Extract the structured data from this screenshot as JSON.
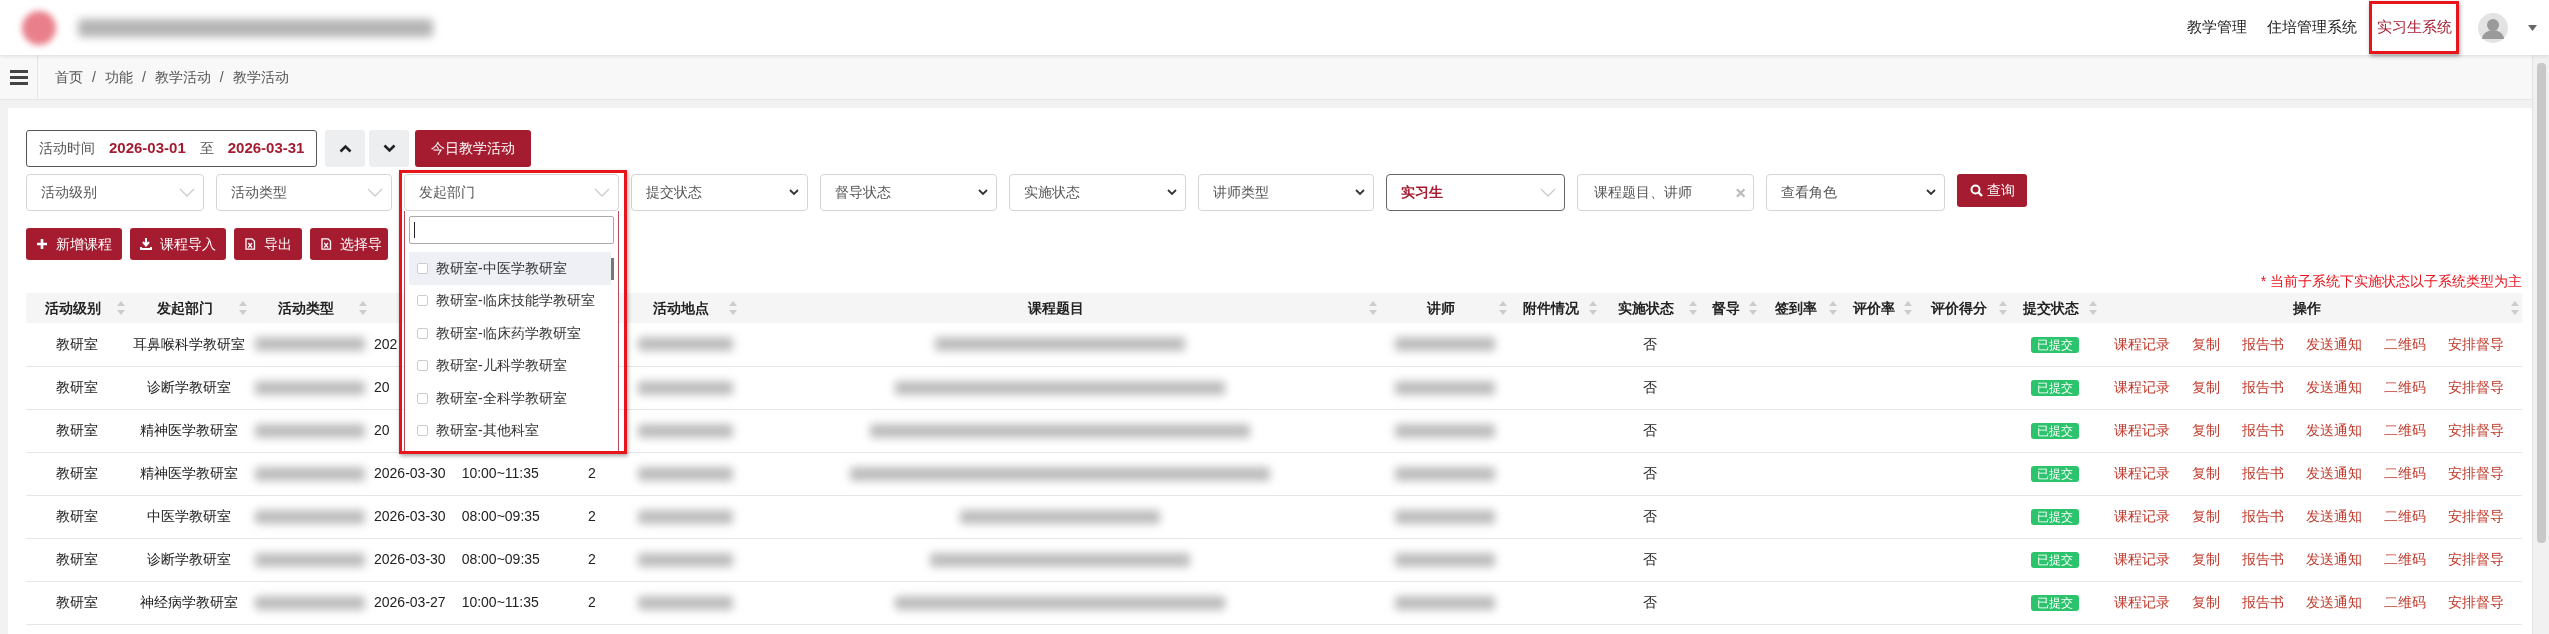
{
  "top_nav": [
    {
      "label": "教学管理",
      "selected": false,
      "highlighted": false
    },
    {
      "label": "住培管理系统",
      "selected": false,
      "highlighted": false
    },
    {
      "label": "实习生系统",
      "selected": true,
      "highlighted": true
    }
  ],
  "breadcrumb": {
    "separator": "/",
    "items": [
      "首页",
      "功能",
      "教学活动",
      "教学活动"
    ]
  },
  "date_range": {
    "label": "活动时间",
    "start": "2026-03-01",
    "separator": "至",
    "end": "2026-03-31"
  },
  "today_button": "今日教学活动",
  "filters": [
    {
      "kind": "select2",
      "placeholder": "活动级别"
    },
    {
      "kind": "select2",
      "placeholder": "活动类型"
    },
    {
      "kind": "select2",
      "placeholder": "发起部门",
      "open": true,
      "highlighted": true,
      "options": [
        {
          "label": "教研室-中医学教研室",
          "checked": false,
          "highlighted": true
        },
        {
          "label": "教研室-临床技能学教研室",
          "checked": false,
          "highlighted": false
        },
        {
          "label": "教研室-临床药学教研室",
          "checked": false,
          "highlighted": false
        },
        {
          "label": "教研室-儿科学教研室",
          "checked": false,
          "highlighted": false
        },
        {
          "label": "教研室-全科学教研室",
          "checked": false,
          "highlighted": false
        },
        {
          "label": "教研室-其他科室",
          "checked": false,
          "highlighted": false
        }
      ]
    },
    {
      "kind": "select",
      "placeholder": "提交状态"
    },
    {
      "kind": "select",
      "placeholder": "督导状态"
    },
    {
      "kind": "select",
      "placeholder": "实施状态"
    },
    {
      "kind": "select",
      "placeholder": "讲师类型"
    },
    {
      "kind": "select2",
      "value": "实习生"
    },
    {
      "kind": "search",
      "placeholder": "课程题目、讲师"
    },
    {
      "kind": "select",
      "placeholder": "查看角色"
    }
  ],
  "query_button": "查询",
  "action_buttons": [
    {
      "kind": "plus",
      "label": "新增课程"
    },
    {
      "kind": "download",
      "label": "课程导入"
    },
    {
      "kind": "excel",
      "label": "导出"
    },
    {
      "kind": "excel",
      "label": "选择导"
    }
  ],
  "note": "* 当前子系统下实施状态以子系统类型为主",
  "table": {
    "columns": [
      {
        "kind": "text",
        "label": "活动级别"
      },
      {
        "kind": "text",
        "label": "发起部门"
      },
      {
        "kind": "text",
        "label": "活动类型"
      },
      {
        "kind": "covered"
      },
      {
        "kind": "covered"
      },
      {
        "kind": "text",
        "label": "活动地点"
      },
      {
        "kind": "text",
        "label": "课程题目"
      },
      {
        "kind": "text",
        "label": "讲师"
      },
      {
        "kind": "text",
        "label": "附件情况"
      },
      {
        "kind": "text",
        "label": "实施状态"
      },
      {
        "kind": "text",
        "label": "督导"
      },
      {
        "kind": "text",
        "label": "签到率"
      },
      {
        "kind": "text",
        "label": "评价率"
      },
      {
        "kind": "text",
        "label": "评价得分"
      },
      {
        "kind": "text",
        "label": "提交状态"
      },
      {
        "kind": "text",
        "label": "操作"
      }
    ],
    "rows": [
      {
        "level": "教研室",
        "department": "耳鼻喉科学教研室",
        "date": "202",
        "status": "否",
        "submitted": "已提交",
        "actions": [
          "课程记录",
          "复制",
          "报告书",
          "发送通知",
          "二维码",
          "安排督导"
        ]
      },
      {
        "level": "教研室",
        "department": "诊断学教研室",
        "date": "20",
        "status": "否",
        "submitted": "已提交",
        "actions": [
          "课程记录",
          "复制",
          "报告书",
          "发送通知",
          "二维码",
          "安排督导"
        ]
      },
      {
        "level": "教研室",
        "department": "精神医学教研室",
        "date": "20",
        "status": "否",
        "submitted": "已提交",
        "actions": [
          "课程记录",
          "复制",
          "报告书",
          "发送通知",
          "二维码",
          "安排督导"
        ]
      },
      {
        "level": "教研室",
        "department": "精神医学教研室",
        "date": "2026-03-30",
        "time": "10:00~11:35",
        "count": "2",
        "status": "否",
        "submitted": "已提交",
        "actions": [
          "课程记录",
          "复制",
          "报告书",
          "发送通知",
          "二维码",
          "安排督导"
        ]
      },
      {
        "level": "教研室",
        "department": "中医学教研室",
        "date": "2026-03-30",
        "time": "08:00~09:35",
        "count": "2",
        "status": "否",
        "submitted": "已提交",
        "actions": [
          "课程记录",
          "复制",
          "报告书",
          "发送通知",
          "二维码",
          "安排督导"
        ]
      },
      {
        "level": "教研室",
        "department": "诊断学教研室",
        "date": "2026-03-30",
        "time": "08:00~09:35",
        "count": "2",
        "status": "否",
        "submitted": "已提交",
        "actions": [
          "课程记录",
          "复制",
          "报告书",
          "发送通知",
          "二维码",
          "安排督导"
        ]
      },
      {
        "level": "教研室",
        "department": "神经病学教研室",
        "date": "2026-03-27",
        "time": "10:00~11:35",
        "count": "2",
        "status": "否",
        "submitted": "已提交",
        "actions": [
          "课程记录",
          "复制",
          "报告书",
          "发送通知",
          "二维码",
          "安排督导"
        ]
      }
    ]
  }
}
